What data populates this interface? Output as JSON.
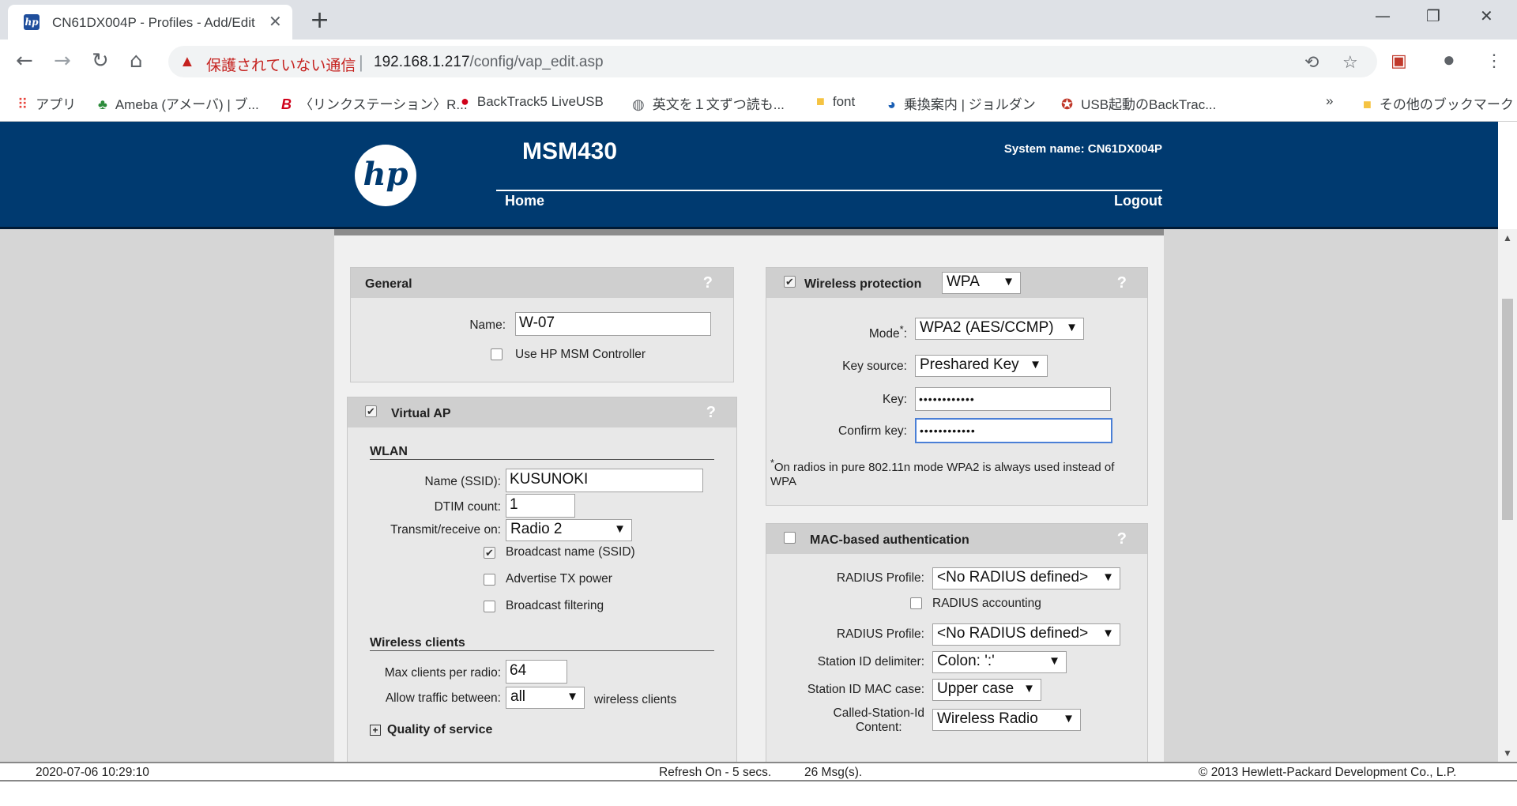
{
  "browser": {
    "tab_title": "CN61DX004P - Profiles - Add/Edit",
    "tab_favicon": "hp",
    "new_tab_label": "+",
    "warning_text": "保護されていない通信",
    "url_host": "192.168.1.217",
    "url_path": "/config/vap_edit.asp",
    "bookmarks": [
      {
        "label": "アプリ",
        "icon": "apps-grid-icon"
      },
      {
        "label": "Ameba (アメーバ) | ブ...",
        "icon": "ameba-icon"
      },
      {
        "label": "〈リンクステーション〉R...",
        "icon": "buffalo-icon"
      },
      {
        "label": "BackTrack5 LiveUSB",
        "icon": "backtrack-icon"
      },
      {
        "label": "英文を１文ずつ読も...",
        "icon": "globe-icon"
      },
      {
        "label": "font",
        "icon": "folder-icon"
      },
      {
        "label": "乗換案内 | ジョルダン",
        "icon": "jorudan-icon"
      },
      {
        "label": "USB起動のBackTrac...",
        "icon": "usb-icon"
      }
    ],
    "bookmarks_overflow": "»",
    "other_bookmarks": "その他のブックマーク"
  },
  "header": {
    "logo": "hp",
    "product": "MSM430",
    "system_name": "System name: CN61DX004P",
    "home": "Home",
    "logout": "Logout"
  },
  "general": {
    "title": "General",
    "help": "?",
    "name_label": "Name:",
    "name_value": "W-07",
    "use_controller_label": "Use HP MSM Controller",
    "use_controller_checked": false
  },
  "virtual_ap": {
    "title": "Virtual AP",
    "help": "?",
    "checked": true,
    "wlan_heading": "WLAN",
    "ssid_label": "Name (SSID):",
    "ssid_value": "KUSUNOKI",
    "dtim_label": "DTIM count:",
    "dtim_value": "1",
    "radio_label": "Transmit/receive on:",
    "radio_value": "Radio 2",
    "broadcast_name_label": "Broadcast name (SSID)",
    "broadcast_name_checked": true,
    "advertise_tx_label": "Advertise TX power",
    "advertise_tx_checked": false,
    "broadcast_filter_label": "Broadcast filtering",
    "broadcast_filter_checked": false,
    "clients_heading": "Wireless clients",
    "max_clients_label": "Max clients per radio:",
    "max_clients_value": "64",
    "allow_traffic_label": "Allow traffic between:",
    "allow_traffic_value": "all",
    "allow_traffic_suffix": "wireless clients",
    "qos_heading": "Quality of service"
  },
  "wireless_protection": {
    "title": "Wireless protection",
    "help": "?",
    "checked": true,
    "type_value": "WPA",
    "mode_label": "Mode",
    "mode_asterisk": "*",
    "mode_colon": ":",
    "mode_value": "WPA2 (AES/CCMP)",
    "key_source_label": "Key source:",
    "key_source_value": "Preshared Key",
    "key_label": "Key:",
    "key_value": "••••••••••••",
    "confirm_key_label": "Confirm key:",
    "confirm_key_value": "••••••••••••",
    "note_mark": "*",
    "note": "On radios in pure 802.11n mode WPA2 is always used instead of WPA"
  },
  "mac_auth": {
    "title": "MAC-based authentication",
    "help": "?",
    "checked": false,
    "radius_profile_label": "RADIUS Profile:",
    "radius_profile_value": "<No RADIUS defined>",
    "radius_accounting_label": "RADIUS accounting",
    "radius_accounting_checked": false,
    "radius_profile2_label": "RADIUS Profile:",
    "radius_profile2_value": "<No RADIUS defined>",
    "station_delim_label": "Station ID delimiter:",
    "station_delim_value": "Colon: ':'",
    "station_case_label": "Station ID MAC case:",
    "station_case_value": "Upper case",
    "called_station_label_1": "Called-Station-Id",
    "called_station_label_2": "Content:",
    "called_station_value": "Wireless Radio"
  },
  "status": {
    "datetime": "2020-07-06 10:29:10",
    "refresh": "Refresh On - 5 secs.",
    "messages": "26 Msg(s).",
    "copyright": "© 2013 Hewlett-Packard Development Co., L.P."
  },
  "colors": {
    "header_bg": "#003a70",
    "panel_head_bg": "#cfcfcf",
    "warning": "#c5221f"
  }
}
